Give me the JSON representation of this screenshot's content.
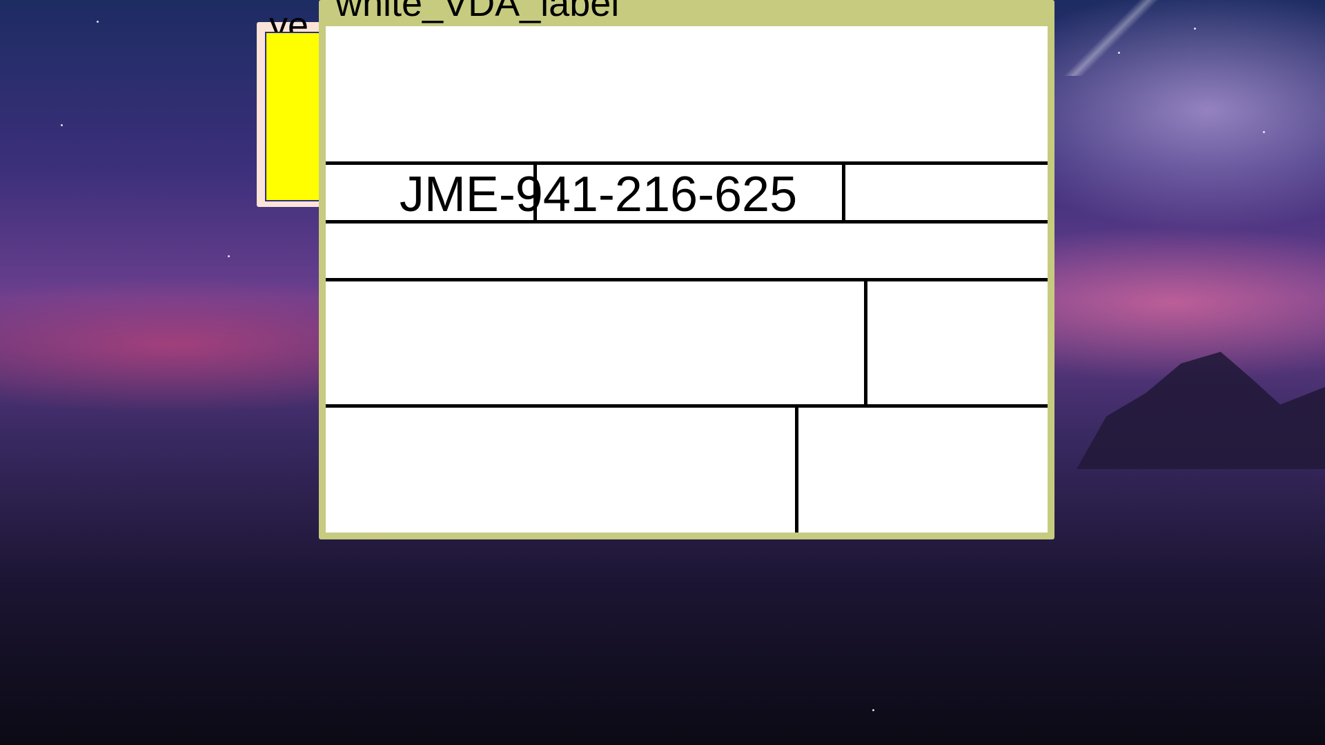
{
  "desktop": {
    "background": "night sky wallpaper with purple clouds and mountains"
  },
  "windows": {
    "yellow": {
      "title": "ye",
      "body_color": "#ffff00",
      "frame_color": "#fbe3d8"
    },
    "label": {
      "title": "white_VDA_label",
      "frame_color": "#c7cb7f",
      "canvas_color": "#ffffff",
      "id_text": "JME-941-216-625"
    }
  }
}
